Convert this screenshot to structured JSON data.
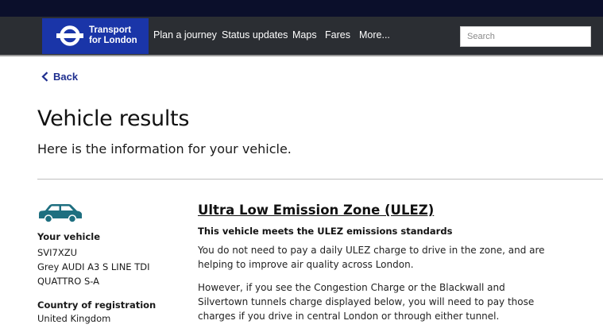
{
  "header": {
    "logo_text_line1": "Transport",
    "logo_text_line2": "for London",
    "nav": [
      "Plan a journey",
      "Status updates",
      "Maps",
      "Fares",
      "More..."
    ],
    "search_placeholder": "Search"
  },
  "back_label": "Back",
  "page_title": "Vehicle results",
  "lead": "Here is the information for your vehicle.",
  "vehicle": {
    "label": "Your vehicle",
    "registration": "SVI7XZU",
    "description_line1": "Grey AUDI A3 S LINE TDI",
    "description_line2": "QUATTRO S-A",
    "country_label": "Country of registration",
    "country": "United Kingdom"
  },
  "ulez": {
    "title": "Ultra Low Emission Zone (ULEZ)",
    "subtitle": "This vehicle meets the ULEZ emissions standards",
    "para1": "You do not need to pay a daily ULEZ charge to drive in the zone, and are helping to improve air quality across London.",
    "para2": "However, if you see the Congestion Charge or the Blackwall and Silvertown tunnels charge displayed below, you will need to pay those charges if you drive in central London or through either tunnel."
  },
  "colors": {
    "brand_blue": "#1a35a8",
    "nav_bg": "#2b2e33",
    "car": "#1e6f80"
  }
}
